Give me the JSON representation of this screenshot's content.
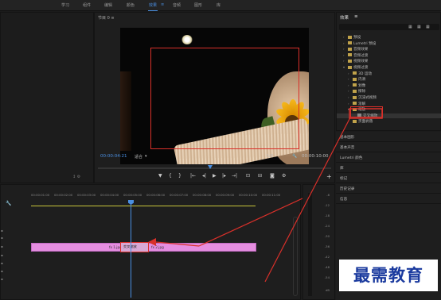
{
  "topbar": {
    "tabs": [
      {
        "label": "学习",
        "active": false
      },
      {
        "label": "组件",
        "active": false
      },
      {
        "label": "编辑",
        "active": false
      },
      {
        "label": "颜色",
        "active": false
      },
      {
        "label": "效果",
        "active": true
      },
      {
        "label": "音频",
        "active": false
      },
      {
        "label": "图形",
        "active": false
      },
      {
        "label": "库",
        "active": false
      }
    ],
    "menu_icon": "hamburger-icon"
  },
  "monitor": {
    "header": "节目 0 ≡",
    "timecode_current": "00:00:04:21",
    "fit": "适合",
    "ratio": "1/2",
    "timecode_total": "00:00:10:00"
  },
  "effects_panel": {
    "title": "效果",
    "menu_icon": "hamburger-icon",
    "tree": [
      {
        "label": "预设",
        "expanded": false,
        "indent": 0
      },
      {
        "label": "Lumetri 预设",
        "expanded": false,
        "indent": 0
      },
      {
        "label": "音频效果",
        "expanded": false,
        "indent": 0
      },
      {
        "label": "音频过渡",
        "expanded": false,
        "indent": 0
      },
      {
        "label": "视频效果",
        "expanded": false,
        "indent": 0
      },
      {
        "label": "视频过渡",
        "expanded": true,
        "indent": 0
      },
      {
        "label": "3D 运动",
        "expanded": false,
        "indent": 1
      },
      {
        "label": "内滑",
        "expanded": false,
        "indent": 1
      },
      {
        "label": "划像",
        "expanded": false,
        "indent": 1
      },
      {
        "label": "擦除",
        "expanded": false,
        "indent": 1
      },
      {
        "label": "沉浸式视频",
        "expanded": false,
        "indent": 1
      },
      {
        "label": "溶解",
        "expanded": false,
        "indent": 1
      },
      {
        "label": "缩放",
        "expanded": true,
        "indent": 1
      },
      {
        "label": "交叉缩放",
        "expanded": false,
        "indent": 2,
        "selected": true
      },
      {
        "label": "页面剥落",
        "expanded": false,
        "indent": 1
      }
    ]
  },
  "side_panels": [
    "基本图形",
    "基本声音",
    "Lumetri 颜色",
    "库",
    "标记",
    "历史记录",
    "信息"
  ],
  "timeline": {
    "ruler": [
      "00:00:01:00",
      "00:00:02:00",
      "00:00:03:00",
      "00:00:04:00",
      "00:00:05:00",
      "00:00:06:00",
      "00:00:07:00",
      "00:00:08:00",
      "00:00:09:00",
      "00:00:10:00",
      "00:00:11:00"
    ],
    "clip_left_label": "fx 1.jpg",
    "transition_label": "交叉缩放",
    "clip_right_label": "fx 2.jpg"
  },
  "meter": {
    "scale": [
      "-6",
      "-12",
      "-18",
      "-24",
      "-30",
      "-36",
      "-42",
      "-48",
      "-54",
      "dB"
    ]
  },
  "watermark": "最需教育"
}
